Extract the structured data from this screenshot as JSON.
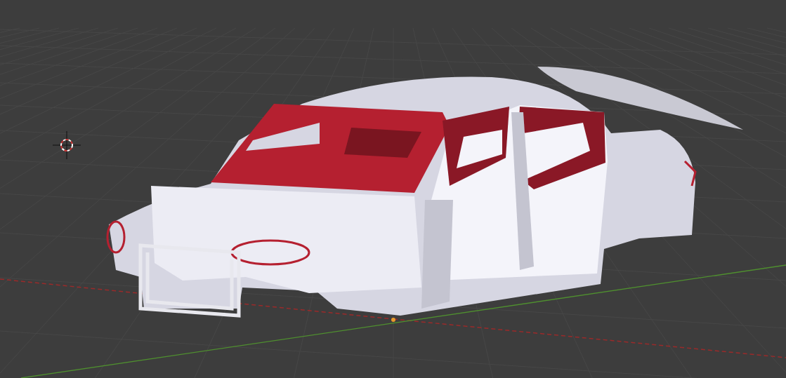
{
  "viewport": {
    "show_grid": true,
    "show_axes": true,
    "show_cursor": true,
    "show_origin": true
  }
}
